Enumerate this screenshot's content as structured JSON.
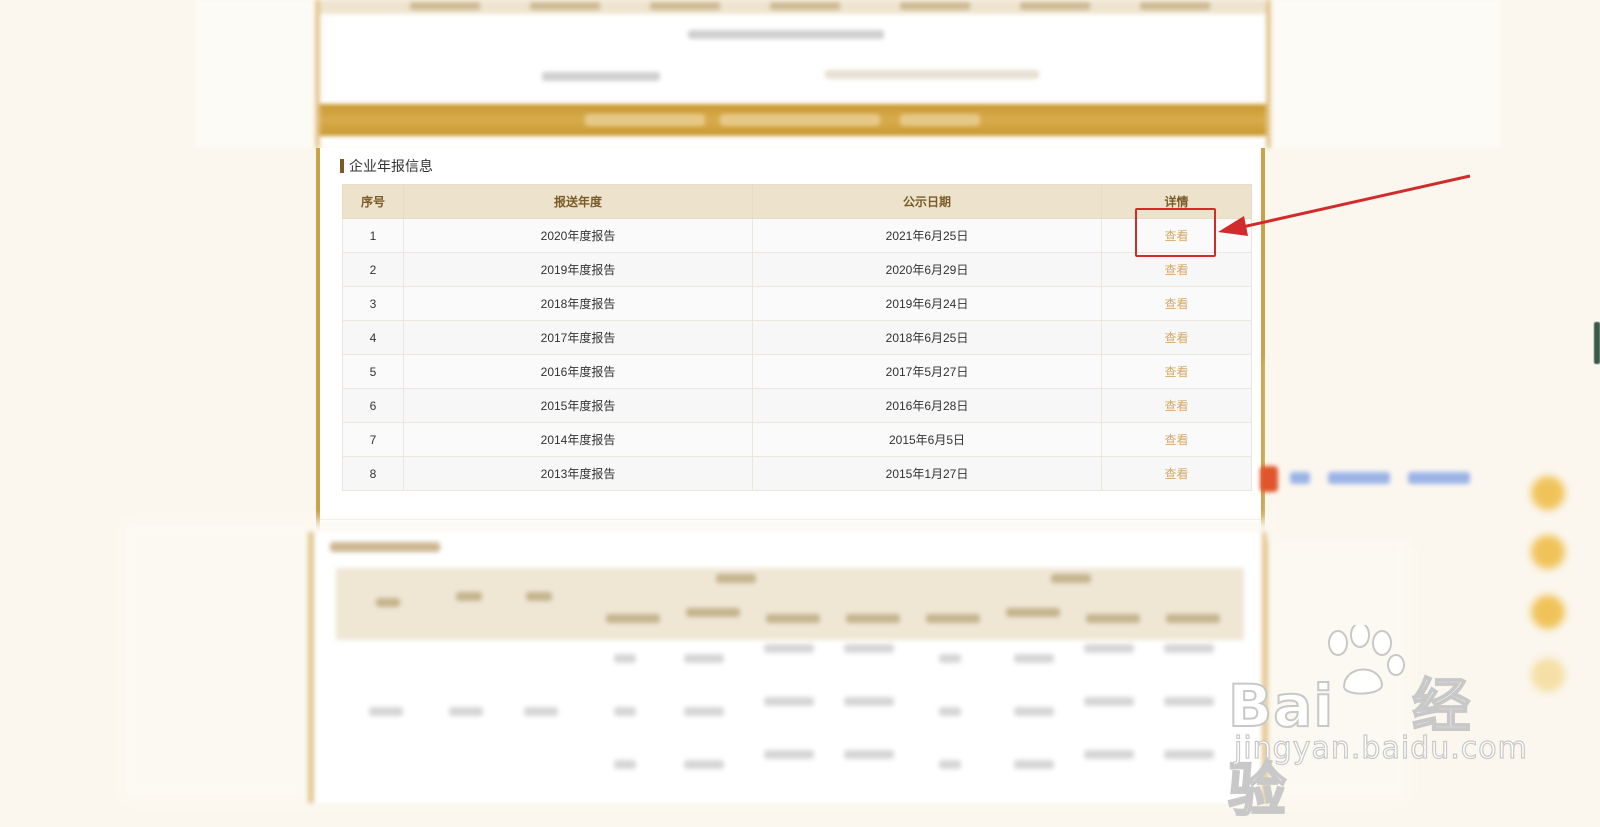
{
  "section": {
    "title": "企业年报信息"
  },
  "table": {
    "headers": [
      "序号",
      "报送年度",
      "公示日期",
      "详情"
    ],
    "rows": [
      {
        "index": "1",
        "year": "2020年度报告",
        "date": "2021年6月25日",
        "action": "查看"
      },
      {
        "index": "2",
        "year": "2019年度报告",
        "date": "2020年6月29日",
        "action": "查看"
      },
      {
        "index": "3",
        "year": "2018年度报告",
        "date": "2019年6月24日",
        "action": "查看"
      },
      {
        "index": "4",
        "year": "2017年度报告",
        "date": "2018年6月25日",
        "action": "查看"
      },
      {
        "index": "5",
        "year": "2016年度报告",
        "date": "2017年5月27日",
        "action": "查看"
      },
      {
        "index": "6",
        "year": "2015年度报告",
        "date": "2016年6月28日",
        "action": "查看"
      },
      {
        "index": "7",
        "year": "2014年度报告",
        "date": "2015年6月5日",
        "action": "查看"
      },
      {
        "index": "8",
        "year": "2013年度报告",
        "date": "2015年1月27日",
        "action": "查看"
      }
    ]
  },
  "watermark": {
    "brand_left": "Bai",
    "brand_right": "经验",
    "url": "jingyan.baidu.com"
  },
  "colors": {
    "accent_gold": "#c9a24a",
    "header_text": "#7a5b28",
    "link": "#d4a868",
    "annotation_red": "#d22b2b"
  }
}
